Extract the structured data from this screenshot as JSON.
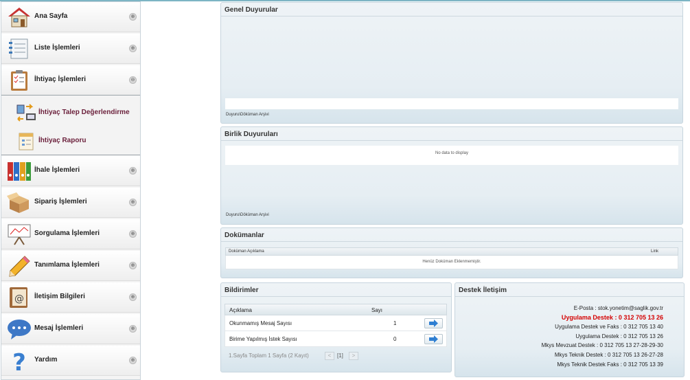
{
  "sidebar": {
    "items": [
      {
        "label": "Ana Sayfa",
        "icon": "house-icon",
        "chevron": "⊕"
      },
      {
        "label": "Liste İşlemleri",
        "icon": "notebook-icon",
        "chevron": "⊕"
      },
      {
        "label": "İhtiyaç İşlemleri",
        "icon": "clipboard-checklist-icon",
        "chevron": "⊖"
      },
      {
        "label": "İhale İşlemleri",
        "icon": "binders-icon",
        "chevron": "⊕"
      },
      {
        "label": "Sipariş İşlemleri",
        "icon": "box-icon",
        "chevron": "⊕"
      },
      {
        "label": "Sorgulama İşlemleri",
        "icon": "presentation-chart-icon",
        "chevron": "⊕"
      },
      {
        "label": "Tanımlama İşlemleri",
        "icon": "pencil-icon",
        "chevron": "⊕"
      },
      {
        "label": "İletişim Bilgileri",
        "icon": "address-book-icon",
        "chevron": "⊕"
      },
      {
        "label": "Mesaj İşlemleri",
        "icon": "speech-bubble-icon",
        "chevron": "⊕"
      },
      {
        "label": "Yardım",
        "icon": "question-mark-icon",
        "chevron": "⊕"
      }
    ],
    "submenu": [
      {
        "label": "İhtiyaç Talep Değerlendirme",
        "icon": "transfer-computer-icon"
      },
      {
        "label": "İhtiyaç Raporu",
        "icon": "report-icon"
      }
    ]
  },
  "panels": {
    "general": {
      "title": "Genel Duyurular",
      "archive": "Duyuru\\Döküman Arşivi"
    },
    "union": {
      "title": "Birlik Duyuruları",
      "no_data": "No data to display",
      "archive": "Duyuru\\Döküman Arşivi"
    },
    "documents": {
      "title": "Dokümanlar",
      "col_desc": "Doküman Açıklama",
      "col_link": "Link",
      "empty": "Henüz Doküman Eklenmemiştir."
    },
    "notifications": {
      "title": "Bildirimler",
      "col_desc": "Açıklama",
      "col_count": "Sayı",
      "rows": [
        {
          "label": "Okunmamış Mesaj Sayısı",
          "count": "1"
        },
        {
          "label": "Birime Yapılmış İstek Sayısı",
          "count": "0"
        }
      ],
      "pager": "1.Sayfa Toplam 1 Sayfa (2 Kayıt)",
      "prev": "<",
      "page": "[1]",
      "next": ">"
    },
    "support": {
      "title": "Destek İletişim",
      "lines": [
        "E-Posta : stok.yonetim@saglik.gov.tr",
        "Uygulama Destek : 0 312 705 13 26",
        "Uygulama Destek ve Faks : 0 312 705 13 40",
        "Uygulama Destek : 0 312 705 13 26",
        "Mkys Mevzuat Destek : 0 312 705 13 27-28-29-30",
        "Mkys Teknik Destek : 0 312 705 13 26-27-28",
        "Mkys Teknik Destek Faks : 0 312 705 13 39"
      ]
    }
  },
  "colors": {
    "accent": "#7db5c4",
    "highlight_red": "#d40000",
    "submenu_text": "#6a1f3a"
  }
}
